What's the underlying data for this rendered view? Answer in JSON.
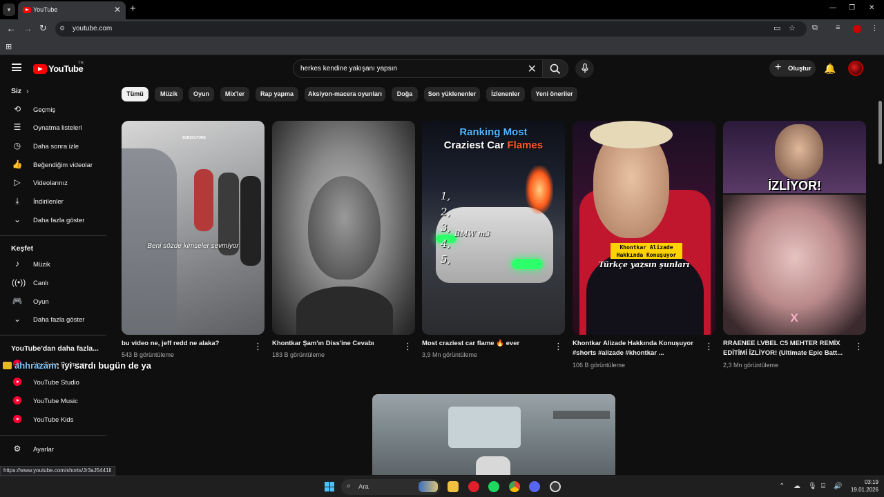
{
  "browser": {
    "tab_title": "YouTube",
    "url": "youtube.com",
    "new_tab": "+",
    "status_url": "https://www.youtube.com/shorts/Jr3aJ5441lI"
  },
  "header": {
    "logo_text": "YouTube",
    "country": "TR",
    "search_value": "herkes kendine yakışanı yapsın",
    "create_label": "Oluştur"
  },
  "sidebar": {
    "you_heading": "Siz",
    "you_items": [
      {
        "label": "Geçmiş",
        "icon": "history-icon"
      },
      {
        "label": "Oynatma listeleri",
        "icon": "playlists-icon"
      },
      {
        "label": "Daha sonra izle",
        "icon": "watch-later-icon"
      },
      {
        "label": "Beğendiğim videolar",
        "icon": "liked-videos-icon"
      },
      {
        "label": "Videolarınız",
        "icon": "your-videos-icon"
      },
      {
        "label": "İndirilenler",
        "icon": "downloads-icon"
      },
      {
        "label": "Daha fazla göster",
        "icon": "chevron-down-icon"
      }
    ],
    "explore_heading": "Keşfet",
    "explore_items": [
      {
        "label": "Müzik",
        "icon": "music-icon"
      },
      {
        "label": "Canlı",
        "icon": "live-icon"
      },
      {
        "label": "Oyun",
        "icon": "gaming-icon"
      },
      {
        "label": "Daha fazla göster",
        "icon": "chevron-down-icon"
      }
    ],
    "more_heading": "YouTube'dan daha fazla...",
    "more_items": [
      {
        "label": "YouTube Premium"
      },
      {
        "label": "YouTube Studio"
      },
      {
        "label": "YouTube Music"
      },
      {
        "label": "YouTube Kids"
      }
    ],
    "settings_label": "Ayarlar"
  },
  "chips": [
    "Tümü",
    "Müzik",
    "Oyun",
    "Mix'ler",
    "Rap yapma",
    "Aksiyon-macera oyunları",
    "Doğa",
    "Son yüklenenler",
    "İzlenenler",
    "Yeni öneriler"
  ],
  "shorts": [
    {
      "title": "bu video ne, jeff redd ne alaka?",
      "views": "543 B görüntüleme",
      "overlay": "Beni sözde kimseler sevmiyor",
      "watermark": "SUBCULTURE"
    },
    {
      "title": "Khontkar Şam'ın Diss'ine Cevabı",
      "views": "183 B görüntüleme"
    },
    {
      "title": "Most craziest car flame 🔥 ever",
      "views": "3,9 Mn görüntüleme",
      "overlay_line1": "Ranking Most",
      "overlay_line2a": "Craziest Car ",
      "overlay_line2b": "Flames",
      "ranks": [
        "1,",
        "2,",
        "3,",
        "4,",
        "5,"
      ],
      "car_label": "BMW m3"
    },
    {
      "title": "Khontkar Alizade Hakkında Konuşuyor #shorts #alizade #khontkar ...",
      "views": "106 B görüntüleme",
      "overlay_box": "Khontkar Alizade Hakkında Konuşuyor",
      "overlay_sub": "Türkçe yazsın şunları"
    },
    {
      "title": "RRAENEE LVBEL C5 MEHTER REMİX EDİTİMİ İZLİYOR! (Ultimate Epic Batt...",
      "views": "2,3 Mn görüntüleme",
      "overlay": "İZLİYOR!",
      "watermark": "X"
    }
  ],
  "chat_overlay": {
    "user": "ahhrazam",
    "message": ": iyi sardı bugün de ya"
  },
  "taskbar": {
    "search_placeholder": "Ara",
    "time": "03:19",
    "date": "19.01.2026"
  }
}
